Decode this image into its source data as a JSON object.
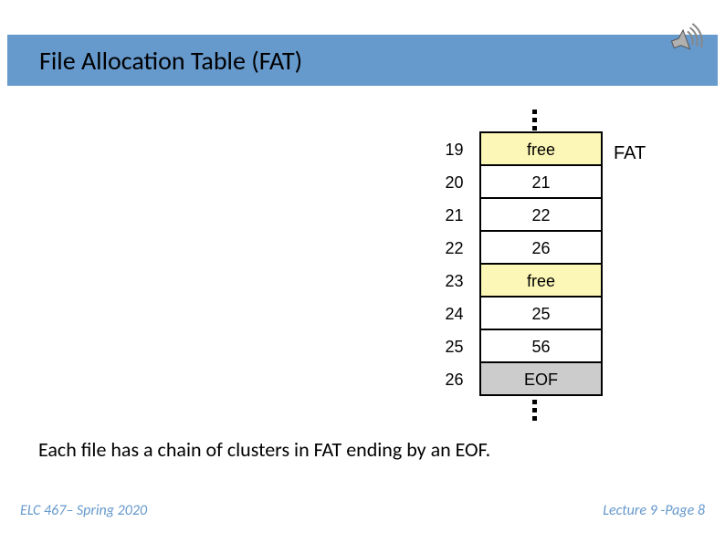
{
  "title": "File Allocation Table (FAT)",
  "fat_label": "FAT",
  "rows": [
    {
      "idx": "19",
      "val": "free",
      "cls": "free"
    },
    {
      "idx": "20",
      "val": "21",
      "cls": ""
    },
    {
      "idx": "21",
      "val": "22",
      "cls": ""
    },
    {
      "idx": "22",
      "val": "26",
      "cls": ""
    },
    {
      "idx": "23",
      "val": "free",
      "cls": "free"
    },
    {
      "idx": "24",
      "val": "25",
      "cls": ""
    },
    {
      "idx": "25",
      "val": "56",
      "cls": ""
    },
    {
      "idx": "26",
      "val": "EOF",
      "cls": "eof"
    }
  ],
  "caption": "Each file has a chain of clusters in FAT ending by an EOF.",
  "footer_left": "ELC 467– Spring 2020",
  "footer_right": "Lecture 9 -Page 8"
}
